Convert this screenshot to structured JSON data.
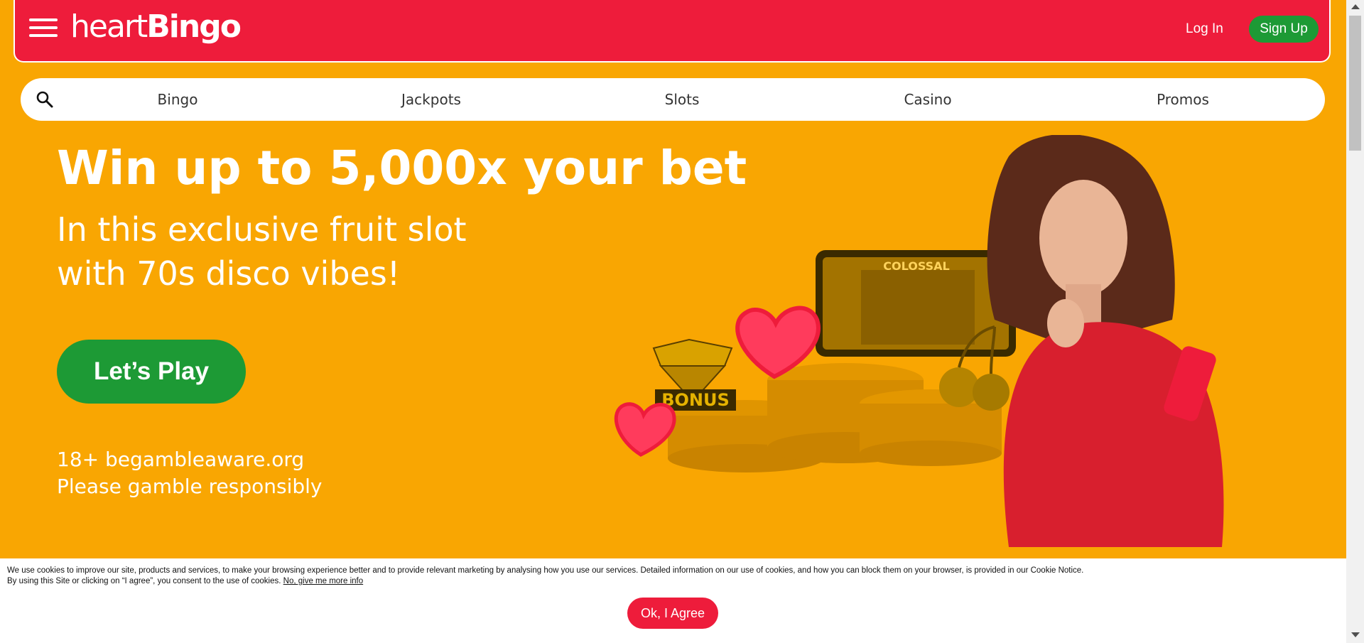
{
  "header": {
    "logo_part1": "heart",
    "logo_part2": "Bingo",
    "login_label": "Log In",
    "signup_label": "Sign Up"
  },
  "nav": {
    "items": [
      {
        "label": "Bingo"
      },
      {
        "label": "Jackpots"
      },
      {
        "label": "Slots"
      },
      {
        "label": "Casino"
      },
      {
        "label": "Promos"
      }
    ]
  },
  "hero": {
    "headline": "Win up to 5,000x your bet",
    "subline_1": "In this exclusive fruit slot",
    "subline_2": "with 70s disco vibes!",
    "cta_label": "Let’s Play",
    "age_notice": "18+ begambleaware.org",
    "responsible": "Please gamble responsibly",
    "art_bonus": "BONUS",
    "art_game_title": "COLOSSAL"
  },
  "cookie": {
    "line1": "We use cookies to improve our site, products and services, to make your browsing experience better and to provide relevant marketing by analysing how you use our services. Detailed information on our use of cookies, and how you can block them on your browser, is provided in our Cookie Notice.",
    "line2": "By using this Site or clicking on “I agree”, you consent to the use of cookies.",
    "more_link": "No, give me more info",
    "agree_label": "Ok, I Agree"
  },
  "colors": {
    "brand_red": "#ee1c3b",
    "hero_yellow": "#f9a602",
    "cta_green": "#1d9a35"
  },
  "icons": [
    "menu-icon",
    "search-icon",
    "scroll-up-icon",
    "scroll-down-icon"
  ]
}
